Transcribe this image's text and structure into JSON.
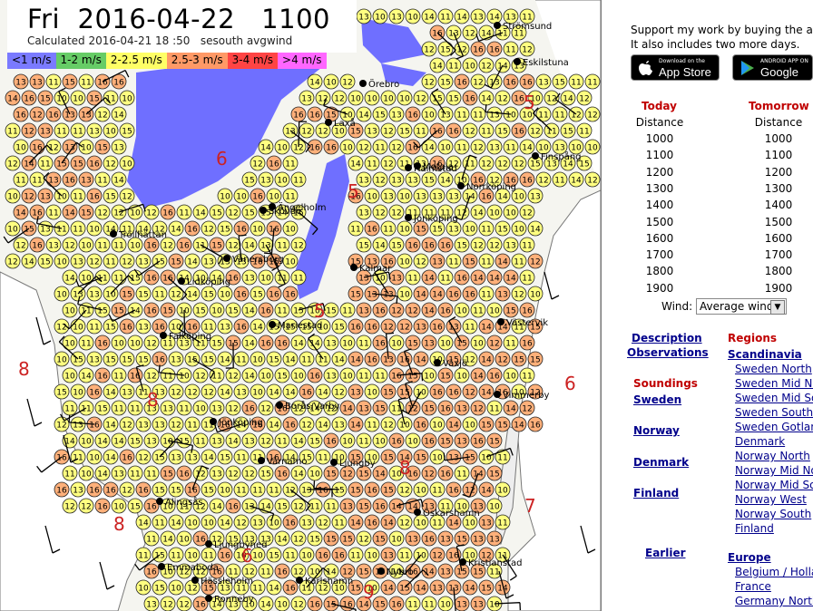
{
  "header": {
    "title": "Fri  2016-04-22   1100",
    "subtitle": "Calculated 2016-04-21 18 :50   sesouth avgwind"
  },
  "legend": [
    {
      "label": "<1 m/s",
      "color": "#7a7aff"
    },
    {
      "label": "1-2 m/s",
      "color": "#66cc66"
    },
    {
      "label": "2-2.5 m/s",
      "color": "#ffff66"
    },
    {
      "label": "2.5-3 m/s",
      "color": "#ff9966"
    },
    {
      "label": "3-4 m/s",
      "color": "#ff4444"
    },
    {
      "label": ">4 m/s",
      "color": "#ff66ff"
    }
  ],
  "map": {
    "cities": [
      "Strömsund",
      "Eskilstuna",
      "Örebro",
      "Laxå",
      "Motala",
      "Finspång",
      "Norrköping",
      "Jönköping",
      "Mariestad",
      "Lidköping",
      "Trollhättan",
      "Vänersborg",
      "Falköping",
      "Alingsås",
      "Borås/Varby",
      "Jönköping",
      "Värnamo",
      "Ljungby",
      "Växjö",
      "Vimmerby",
      "Västervik",
      "Oskarshamn",
      "Nybro",
      "Emmaboda",
      "Halmstad",
      "Ängelholm",
      "Hässleholm",
      "Kalmar",
      "Karlshamn",
      "Ronneby",
      "Kristianstad",
      "Ljungbyhed",
      "Skövde"
    ],
    "region_numbers": [
      "6",
      "5",
      "5",
      "8",
      "8",
      "8",
      "7",
      "8",
      "9",
      "6",
      "5",
      "6"
    ]
  },
  "panel": {
    "support_line1": "Support my work by buying the app",
    "support_line2": "It also includes two more days.",
    "appstore_small": "Download on the",
    "appstore_big": "App Store",
    "google_small": "ANDROID APP ON",
    "google_big": "Google play",
    "today_label": "Today",
    "tomorrow_label": "Tomorrow",
    "distance_label": "Distance",
    "today_times": [
      "1000",
      "1100",
      "1200",
      "1300",
      "1400",
      "1500",
      "1600",
      "1700",
      "1800",
      "1900"
    ],
    "tomorrow_times": [
      "1000",
      "1100",
      "1200",
      "1300",
      "1400",
      "1500",
      "1600",
      "1700",
      "1800",
      "1900"
    ],
    "wind_label": "Wind:",
    "wind_value": "Average wind",
    "links": {
      "description": "Description",
      "observations": "Observations",
      "soundings": "Soundings",
      "sweden": "Sweden",
      "norway": "Norway",
      "denmark": "Denmark",
      "finland": "Finland",
      "earlier": "Earlier"
    },
    "regions_label": "Regions",
    "scandinavia": "Scandinavia",
    "region_links": [
      "Sweden North",
      "Sweden Mid No",
      "Sweden Mid So",
      "Sweden South",
      "Sweden Gotlan",
      "Denmark",
      "Norway North",
      "Norway Mid No",
      "Norway Mid So",
      "Norway West",
      "Norway South",
      "Finland"
    ],
    "europe": "Europe",
    "europe_links": [
      "Belgium / Holla",
      "France",
      "Germany North"
    ]
  },
  "colors": {
    "lake": "#6f6fff",
    "land": "#f5f5f0",
    "circle_yellow": "#ffff80",
    "circle_orange": "#ffb07a",
    "regions_red": "#c00000",
    "link_blue": "#00008b"
  }
}
